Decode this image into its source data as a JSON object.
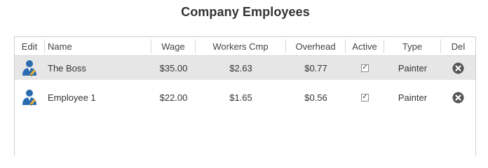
{
  "title": "Company Employees",
  "columns": {
    "edit": "Edit",
    "name": "Name",
    "wage": "Wage",
    "workers_cmp": "Workers Cmp",
    "overhead": "Overhead",
    "active": "Active",
    "type": "Type",
    "del": "Del"
  },
  "rows": [
    {
      "name": "The Boss",
      "wage": "$35.00",
      "workers_cmp": "$2.63",
      "overhead": "$0.77",
      "active": true,
      "active_mark": "✓",
      "type": "Painter",
      "edit_icon": "user-edit-icon",
      "delete_icon": "close-circle-icon",
      "selected": true
    },
    {
      "name": "Employee 1",
      "wage": "$22.00",
      "workers_cmp": "$1.65",
      "overhead": "$0.56",
      "active": true,
      "active_mark": "✓",
      "type": "Painter",
      "edit_icon": "user-edit-icon",
      "delete_icon": "close-circle-icon",
      "selected": false
    }
  ],
  "colors": {
    "selected_row": "#e6e6e6",
    "border": "#cfcfcf",
    "icon_blue": "#2b6cb0",
    "delete_icon": "#555555"
  }
}
